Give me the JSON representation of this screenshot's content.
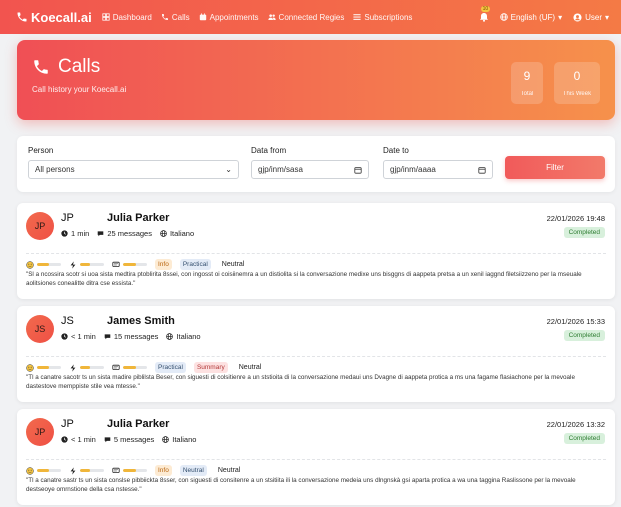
{
  "nav": {
    "brand": "Koecall.ai",
    "links": [
      {
        "label": "Dashboard",
        "icon": "dashboard-icon"
      },
      {
        "label": "Calls",
        "icon": "phone-icon"
      },
      {
        "label": "Appointments",
        "icon": "calendar-icon"
      },
      {
        "label": "Connected Regies",
        "icon": "users-icon"
      },
      {
        "label": "Subscriptions",
        "icon": "list-icon"
      }
    ],
    "notifications_badge": "10",
    "language": "English (UF)",
    "user": "User"
  },
  "hero": {
    "title": "Calls",
    "subtitle": "Call history your Koecall.ai",
    "stats": [
      {
        "value": "9",
        "label": "Total"
      },
      {
        "value": "0",
        "label": "This Week"
      }
    ]
  },
  "filter": {
    "person_label": "Person",
    "person_value": "All persons",
    "date_from_label": "Data from",
    "date_from_value": "gjp/inm/sasa",
    "date_to_label": "Date to",
    "date_to_value": "gjp/inm/aaaa",
    "button": "Filter"
  },
  "calls": [
    {
      "avatar": "JP",
      "initials": "JP",
      "name": "Julia Parker",
      "duration": "1 min",
      "messages": "25 messages",
      "language": "Italiano",
      "date": "22/01/2026 19:48",
      "status": "Completed",
      "levels": [
        0.5,
        0.4,
        0.55
      ],
      "tags": [
        {
          "text": "Info",
          "style": "orange"
        },
        {
          "text": "Practical",
          "style": "blue"
        }
      ],
      "mood": "Neutral",
      "summary": "\"Sl a ncossira scotr si uoa sista medtira ptoblirita 8ssei, con ingosst oi coisiinemra a un distiolita si la conversazione medixe uns bisggns di aappeta pretsa a un xenil iaggnd filetsiizzeno per la mseuale aolitsiones conealitte ditra cse essista.\""
    },
    {
      "avatar": "JS",
      "initials": "JS",
      "name": "James Smith",
      "duration": "< 1 min",
      "messages": "15 messages",
      "language": "Italiano",
      "date": "22/01/2026 15:33",
      "status": "Completed",
      "levels": [
        0.5,
        0.4,
        0.55
      ],
      "tags": [
        {
          "text": "Practical",
          "style": "blue"
        },
        {
          "text": "Summary",
          "style": "pink"
        }
      ],
      "mood": "Neutral",
      "summary": "\"Tl a canatre sacotr ts un sista madire piblilsta Beser, con siguesti di colsitienre a un ststioita di la conversazione medaui uns Dvagne di aappeta protica a ms una fagame flasiachone per la mevoale dastestove memppiste stile vea mtesse.\""
    },
    {
      "avatar": "JP",
      "initials": "JP",
      "name": "Julia Parker",
      "duration": "< 1 min",
      "messages": "5 messages",
      "language": "Italiano",
      "date": "22/01/2026 13:32",
      "status": "Completed",
      "levels": [
        0.5,
        0.4,
        0.55
      ],
      "tags": [
        {
          "text": "Info",
          "style": "orange"
        },
        {
          "text": "Neutral",
          "style": "blue"
        }
      ],
      "mood": "Neutral",
      "summary": "\"Tl a canatre sastr ts un sista conslse pibbiickta 8sser, con siguesti di consitenre a un stsitiita ili la conversazione medeia uns dlngnskà gsi aparta protica a wa una taggina Raslissone per la mevoale destseoye omrnstione della csa nstesse.\""
    }
  ]
}
